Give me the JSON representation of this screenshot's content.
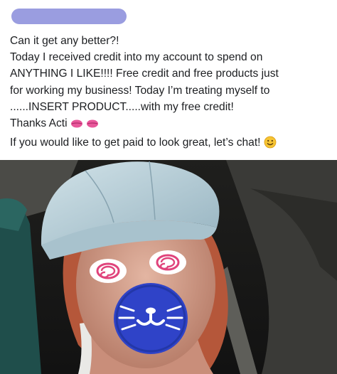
{
  "post": {
    "author_redacted": true,
    "lines": [
      "Can it get any better?!",
      "Today I received credit into my account to spend on",
      "ANYTHING I LIKE!!!! Free credit and free products just",
      "for working my business! Today I’m treating myself to",
      "......INSERT PRODUCT.....with my free credit!",
      "Thanks Acti",
      "If you would like to get paid to look great, let’s chat!"
    ],
    "emojis": [
      "kiss-mark-icon",
      "kiss-mark-icon",
      "smiling-face-icon"
    ]
  },
  "photo": {
    "description_icons": [
      "spiral-eye-sticker-icon",
      "cat-mouth-sticker-icon"
    ],
    "colors": {
      "hat": "#b9cfd8",
      "hair": "#b5573a",
      "skin": "#d3a08d",
      "sticker_blue": "#2f43c8",
      "spiral_pink": "#e0447c"
    }
  }
}
